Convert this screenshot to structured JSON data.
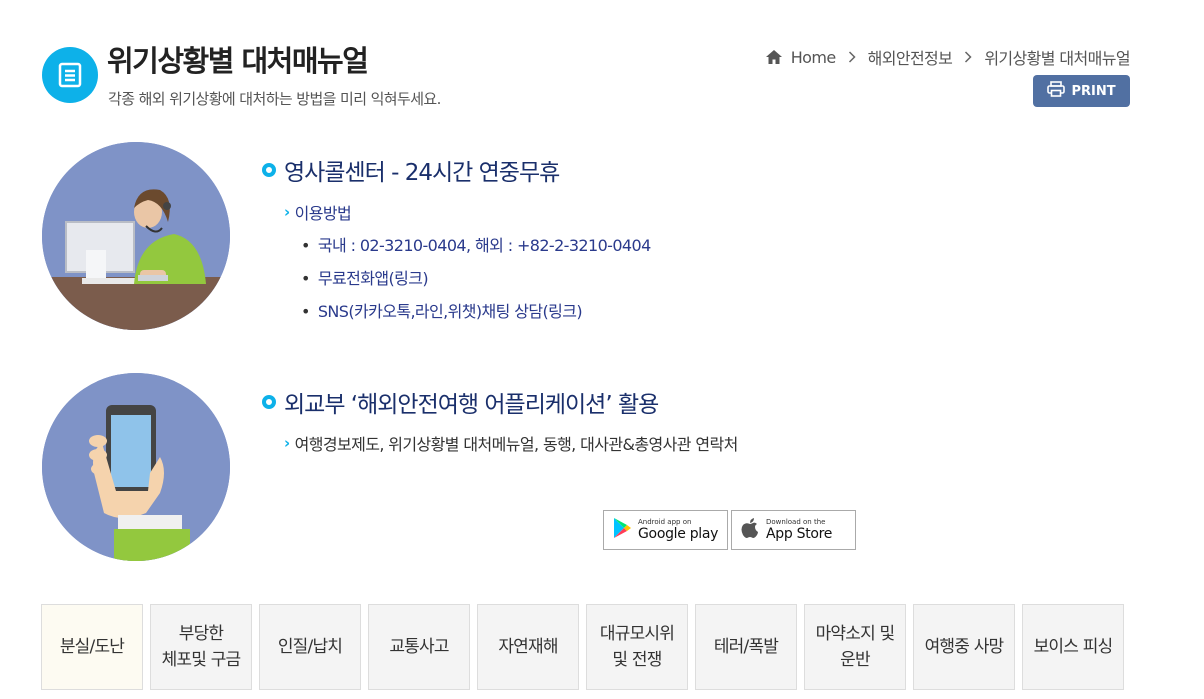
{
  "header": {
    "title": "위기상황별 대처매뉴얼",
    "subtitle": "각종 해외 위기상황에 대처하는 방법을 미리 익혀두세요."
  },
  "breadcrumb": [
    "Home",
    "해외안전정보",
    "위기상황별 대처매뉴얼"
  ],
  "print_label": "PRINT",
  "section1": {
    "title": "영사콜센터  -  24시간 연중무휴",
    "subhead": "이용방법",
    "items": [
      "국내 : 02-3210-0404, 해외 : +82-2-3210-0404",
      "무료전화앱(링크)",
      "SNS(카카오톡,라인,위챗)채팅 상담(링크)"
    ]
  },
  "section2": {
    "title": "외교부 ‘해외안전여행 어플리케이션’ 활용",
    "subhead": "여행경보제도, 위기상황별 대처메뉴얼, 동행, 대사관&총영사관 연락처",
    "google": {
      "small": "Android app on",
      "big": "Google play"
    },
    "apple": {
      "small": "Download on the",
      "big": "App Store"
    }
  },
  "tabs": [
    "분실/도난",
    "부당한\n체포및 구금",
    "인질/납치",
    "교통사고",
    "자연재해",
    "대규모시위\n및 전쟁",
    "테러/폭발",
    "마약소지 및\n운반",
    "여행중 사망",
    "보이스 피싱"
  ],
  "colors": {
    "accent": "#0db1e9",
    "title_blue": "#1a2f6b",
    "print_button": "#5170a2",
    "illustration_bg": "#7f93c7"
  }
}
